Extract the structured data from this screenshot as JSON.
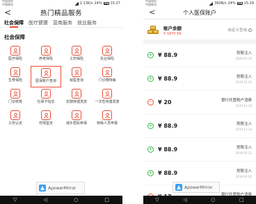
{
  "left": {
    "status": {
      "carrier1": "中国电信",
      "carrier2": "中国移动",
      "speed": "1.13K/s",
      "battery": "24%",
      "time": "15:27"
    },
    "header": {
      "title": "热门精品服务",
      "back": "<"
    },
    "tabs": [
      {
        "label": "社会保障",
        "active": true
      },
      {
        "label": "医疗健康",
        "active": false
      },
      {
        "label": "营商服务",
        "active": false
      },
      {
        "label": "就业服务",
        "active": false
      }
    ],
    "section_title": "社会保障",
    "grid": [
      {
        "label": "医疗保险",
        "icon": "medical-kit-icon"
      },
      {
        "label": "养老保险",
        "icon": "elder-icon"
      },
      {
        "label": "工伤保险",
        "icon": "injury-icon"
      },
      {
        "label": "失业保险",
        "icon": "briefcase-icon"
      },
      {
        "label": "生育保险",
        "icon": "baby-icon"
      },
      {
        "label": "医保账户查询",
        "icon": "account-search-icon",
        "highlight": true
      },
      {
        "label": "就医查询",
        "icon": "search-doc-icon"
      },
      {
        "label": "门诊慢特病",
        "icon": "clinic-icon"
      },
      {
        "label": "门诊统筹",
        "icon": "hospital-icon"
      },
      {
        "label": "社保卡信息",
        "icon": "card-icon"
      },
      {
        "label": "定期待遇发放",
        "icon": "calendar-icon"
      },
      {
        "label": "一次性待遇发放",
        "icon": "money-icon"
      },
      {
        "label": "工伤认定",
        "icon": "badge-icon"
      },
      {
        "label": "伤残鉴定",
        "icon": "shield-icon"
      },
      {
        "label": "城乡居民参保",
        "icon": "people-icon"
      },
      {
        "label": "特殊人员申报",
        "icon": "form-icon"
      }
    ],
    "watermark": "ApowerMirror"
  },
  "right": {
    "status": {
      "carrier1": "中国电信",
      "carrier2": "中国移动",
      "speed": "360B/s",
      "battery": "24%",
      "time": "15:29"
    },
    "header": {
      "title": "个人医保账户",
      "back": "<"
    },
    "account": {
      "label": "账户余额",
      "value": "¥ 1870.59",
      "link": "自定义查询"
    },
    "transactions": [
      {
        "sign": "+",
        "amount": "¥ 88.9",
        "desc": "划账注入",
        "date": "2020-01-10"
      },
      {
        "sign": "+",
        "amount": "¥ 88.9",
        "desc": "划账注入",
        "date": "2019-12-11"
      },
      {
        "sign": "-",
        "amount": "¥ 20",
        "desc": "银行托管账户消费",
        "date": "2019-11-16"
      },
      {
        "sign": "+",
        "amount": "¥ 88.9",
        "desc": "划账注入",
        "date": "2019-11-14"
      },
      {
        "sign": "+",
        "amount": "¥ 88.9",
        "desc": "划账注入",
        "date": "2019-10-12"
      },
      {
        "sign": "+",
        "amount": "¥ 88.9",
        "desc": "划账注入",
        "date": "2019-10-04"
      },
      {
        "sign": "-",
        "amount": "¥ 17",
        "desc": "银行托管账户消费",
        "date": "2019-10-03"
      }
    ],
    "watermark": "ApowerMirror"
  },
  "nav": {
    "back": "◁",
    "home": "○",
    "recent": "□",
    "down": "▽"
  },
  "colors": {
    "accent": "#e94b35",
    "plus": "#3bb54a",
    "minus": "#e94b35"
  }
}
